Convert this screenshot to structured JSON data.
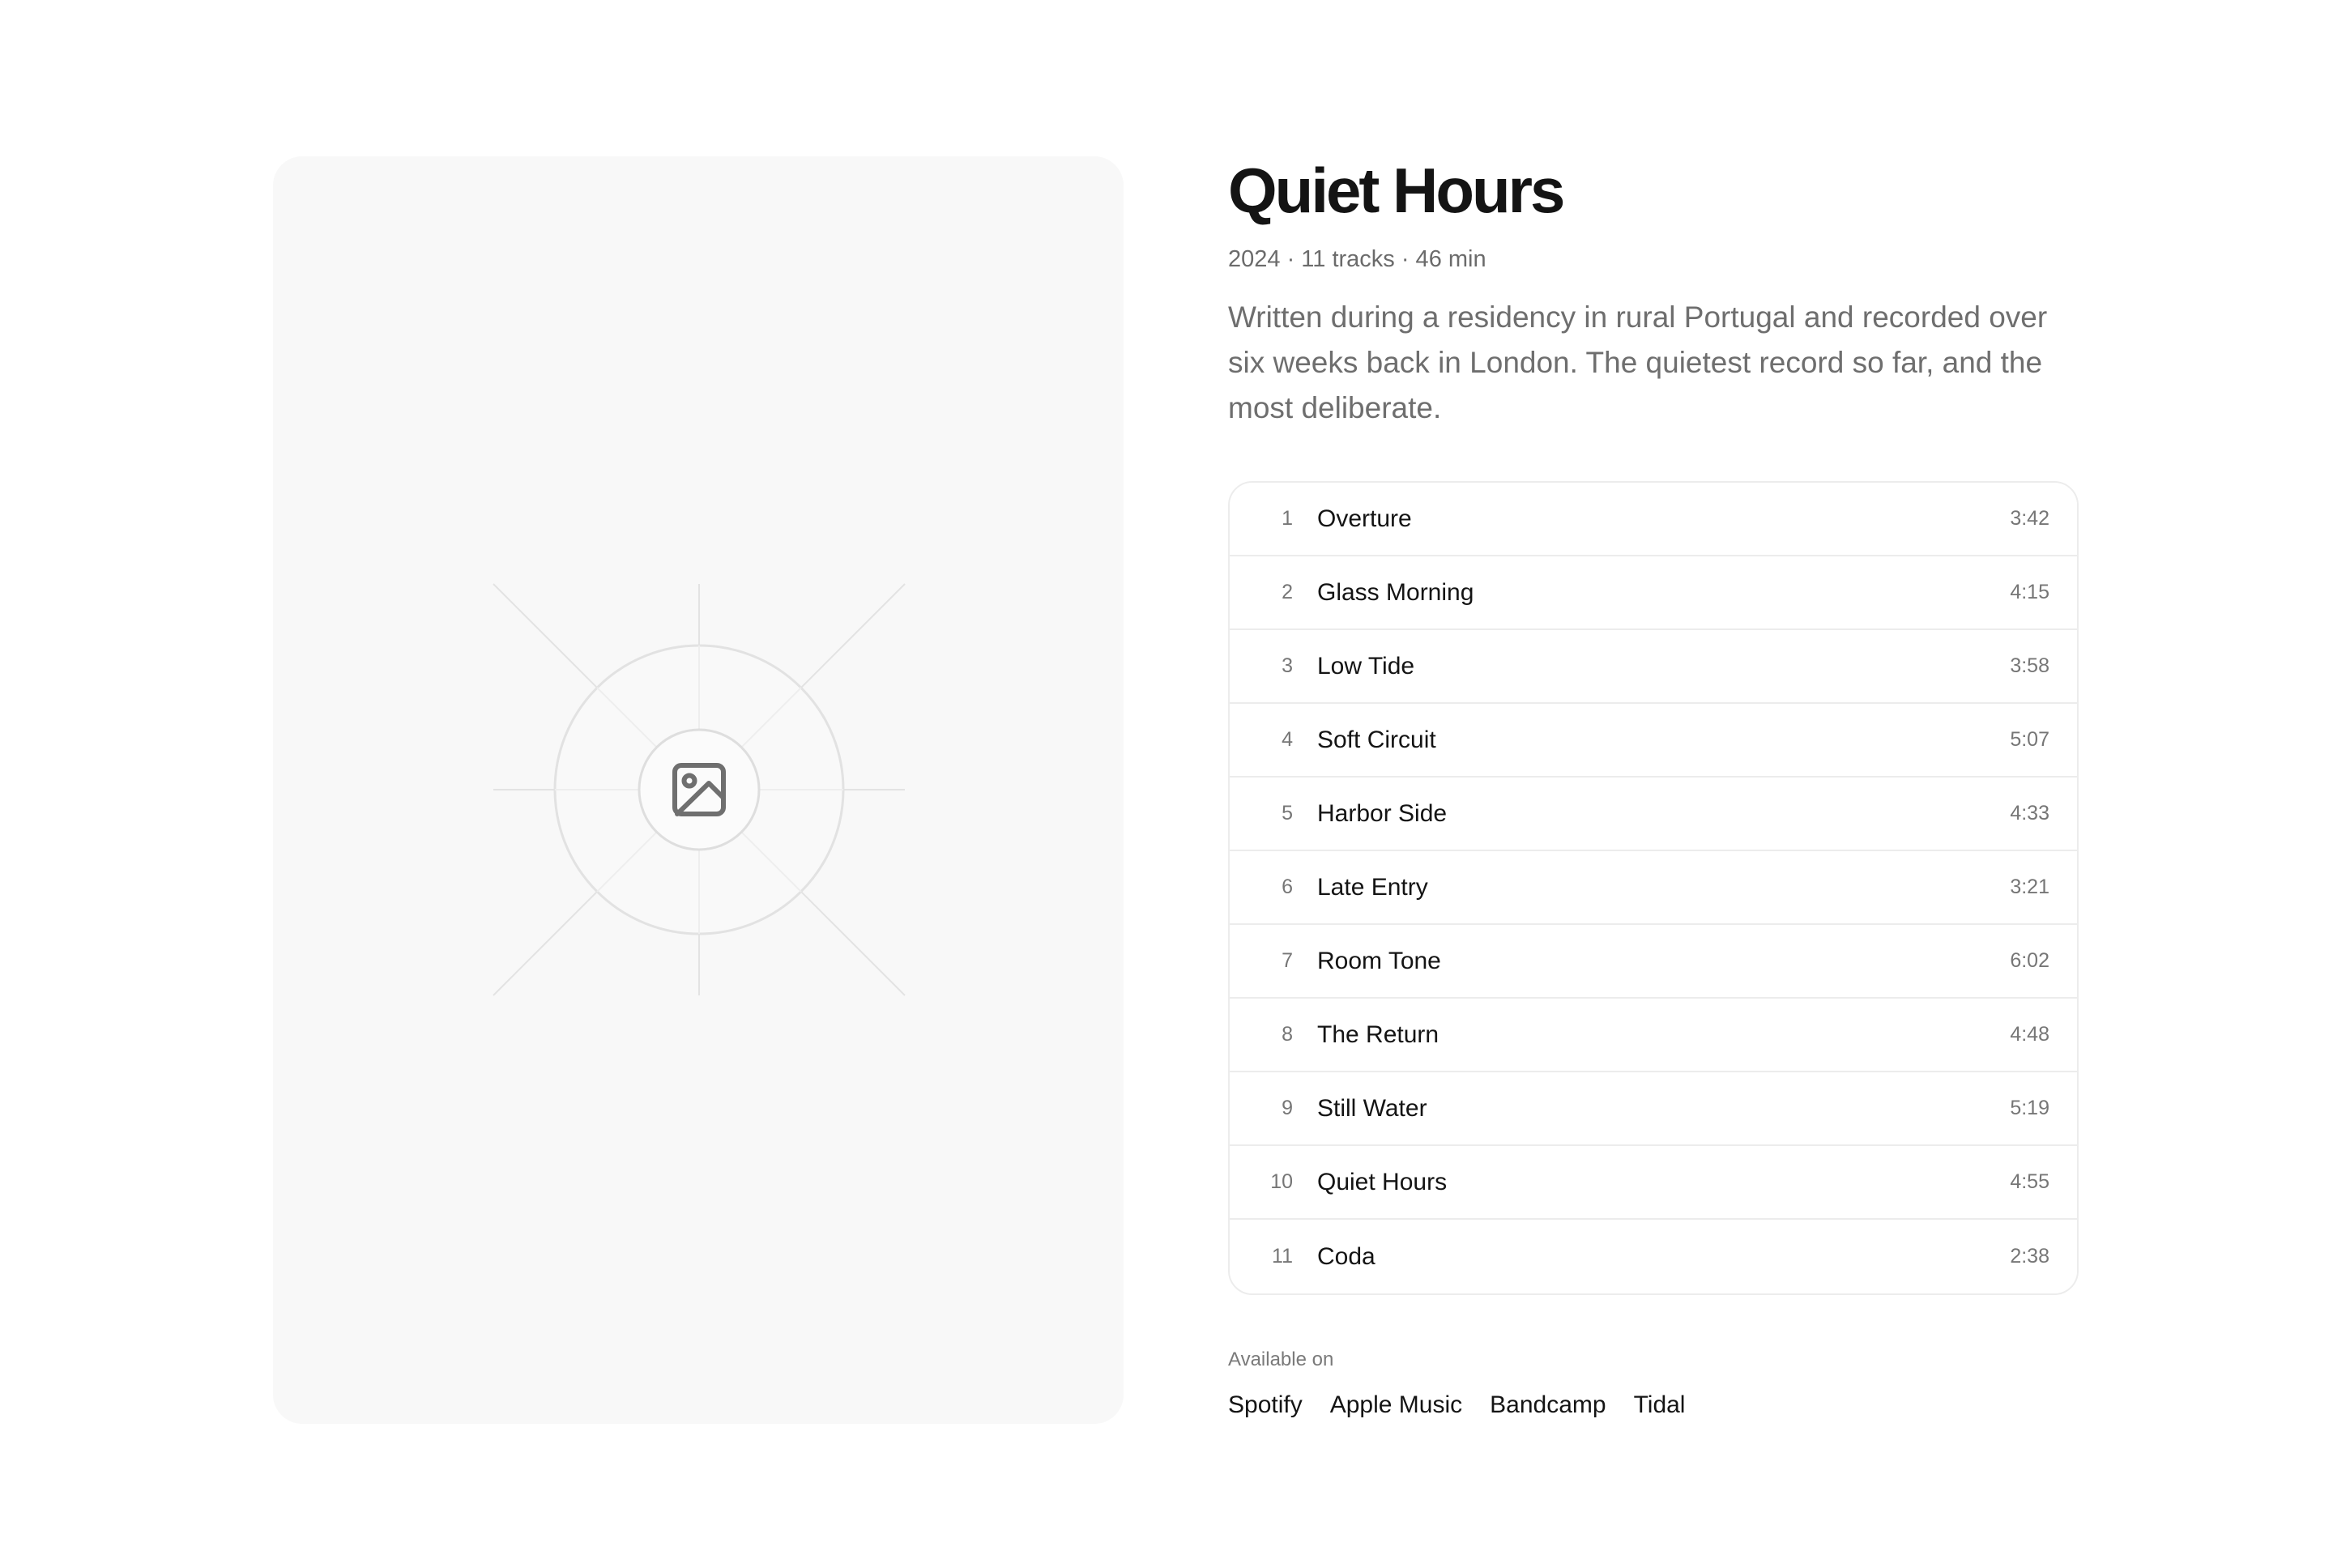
{
  "album": {
    "title": "Quiet Hours",
    "meta": "2024 · 11 tracks · 46 min",
    "description": "Written during a residency in rural Portugal and recorded over six weeks back in London. The quietest record so far, and the most deliberate.",
    "cover_icon": "image-placeholder-icon"
  },
  "tracks": [
    {
      "num": "1",
      "title": "Overture",
      "duration": "3:42"
    },
    {
      "num": "2",
      "title": "Glass Morning",
      "duration": "4:15"
    },
    {
      "num": "3",
      "title": "Low Tide",
      "duration": "3:58"
    },
    {
      "num": "4",
      "title": "Soft Circuit",
      "duration": "5:07"
    },
    {
      "num": "5",
      "title": "Harbor Side",
      "duration": "4:33"
    },
    {
      "num": "6",
      "title": "Late Entry",
      "duration": "3:21"
    },
    {
      "num": "7",
      "title": "Room Tone",
      "duration": "6:02"
    },
    {
      "num": "8",
      "title": "The Return",
      "duration": "4:48"
    },
    {
      "num": "9",
      "title": "Still Water",
      "duration": "5:19"
    },
    {
      "num": "10",
      "title": "Quiet Hours",
      "duration": "4:55"
    },
    {
      "num": "11",
      "title": "Coda",
      "duration": "2:38"
    }
  ],
  "availability": {
    "label": "Available on",
    "platforms": [
      "Spotify",
      "Apple Music",
      "Bandcamp",
      "Tidal"
    ]
  }
}
